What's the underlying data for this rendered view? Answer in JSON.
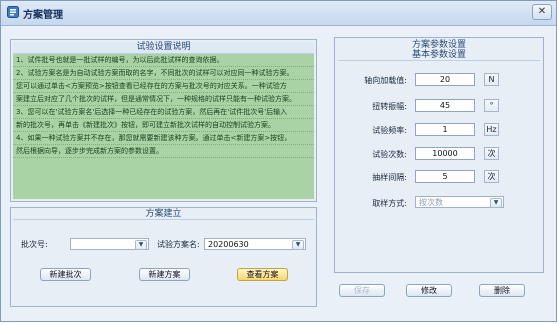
{
  "window": {
    "title": "方案管理",
    "close_glyph": "✕"
  },
  "instructions": {
    "title": "试验设置说明",
    "lines": [
      "1、试件批号也就是一批试样的编号，为以后此批试样的查询依据。",
      "2、试验方案名是为自动试验方案而取的名字，不同批次的试样可以对应同一种试验方案。",
      "您可以通过单击<方案预览>按钮查看已经存在的方案与批次号的对应关系。一种试验方",
      "案建立后对应了几个批次的试样，但是通常情况下，一种规格的试样只能有一种试验方案。",
      "3、您可以在'试验方案名'后选择一种已经存在的试验方案，然后再在'试件批次号'后输入",
      "新的批次号，再单击《新建批次》按钮，即可建立新批次试样的自动控制试验方案。",
      "4、如果一种试验方案并不存在，那您就需要新建该种方案。通过单击<新建方案>按钮，",
      "然后根据向导，逐步步完成新方案的参数设置。"
    ]
  },
  "plan_build": {
    "title": "方案建立",
    "batch_label": "批次号:",
    "batch_value": "",
    "scheme_label": "试验方案名:",
    "scheme_value": "20200630",
    "new_batch_button": "新建批次",
    "new_scheme_button": "新建方案",
    "view_scheme_button": "查看方案"
  },
  "params": {
    "title": "方案参数设置",
    "subtitle": "基本参数设置",
    "rows": [
      {
        "label": "轴向加载值:",
        "value": "20",
        "unit": "N"
      },
      {
        "label": "扭转振幅:",
        "value": "45",
        "unit": "°"
      },
      {
        "label": "试验频率:",
        "value": "1",
        "unit": "Hz"
      },
      {
        "label": "试验次数:",
        "value": "10000",
        "unit": "次"
      },
      {
        "label": "抽样间隔:",
        "value": "5",
        "unit": "次"
      }
    ],
    "sample_mode_label": "取样方式:",
    "sample_mode_value": "按次数"
  },
  "bottom_buttons": {
    "save": "保存",
    "modify": "修改",
    "delete": "删除"
  }
}
